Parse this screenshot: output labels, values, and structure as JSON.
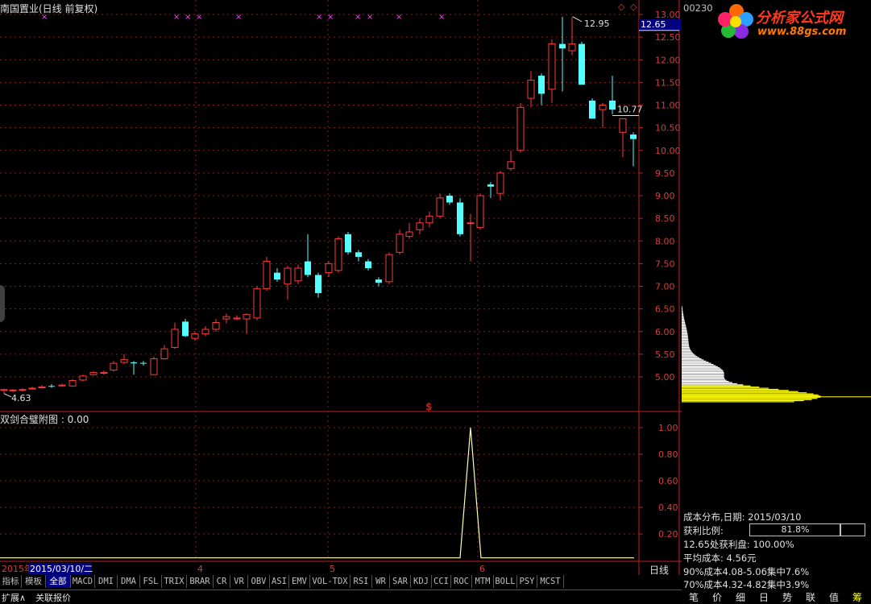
{
  "stock": {
    "title": "南国置业(日线 前复权)",
    "code": "00230"
  },
  "top_chart": {
    "price_axis": [
      "13.00",
      "12.50",
      "12.00",
      "11.50",
      "11.00",
      "10.50",
      "10.00",
      "9.50",
      "9.00",
      "8.50",
      "8.00",
      "7.50",
      "7.00",
      "6.50",
      "6.00",
      "5.50",
      "5.00"
    ],
    "high_label": "12.95",
    "mid_label": "10.77",
    "low_label": "4.63",
    "current_price": "12.65",
    "month_labels": [
      "4",
      "5",
      "6"
    ],
    "event_marker": "$",
    "top_markers": [
      "×",
      "× × ×",
      "×",
      "× ×",
      "× ×",
      "×",
      "×",
      "×"
    ]
  },
  "bottom_chart": {
    "title": "双剑合璧附图 : 0.00",
    "axis": [
      "1.00",
      "0.80",
      "0.60",
      "0.40",
      "0.20"
    ]
  },
  "time_axis": {
    "year_label": "2015年",
    "cursor_date": "2015/03/10/二"
  },
  "day_button": "日线",
  "zoom": {
    "plus": "+",
    "minus": "-"
  },
  "tabs": [
    "指标",
    "模板",
    "全部",
    "MACD",
    "DMI",
    "DMA",
    "FSL",
    "TRIX",
    "BRAR",
    "CR",
    "VR",
    "OBV",
    "ASI",
    "EMV",
    "VOL-TDX",
    "RSI",
    "WR",
    "SAR",
    "KDJ",
    "CCI",
    "ROC",
    "MTM",
    "BOLL",
    "PSY",
    "MCST"
  ],
  "active_tab": "全部",
  "bottom_bar": {
    "expand": "扩展∧",
    "quote": "关联报价"
  },
  "logo": {
    "main": "分析家公式网",
    "url": "www.88gs.com"
  },
  "cost_panel": {
    "title": "成本分布,日期: 2015/03/10",
    "profit_label": "获利比例:",
    "profit_value": "81.8%",
    "profit_fraction": 0.818,
    "line3": "12.65处获利盘: 100.00%",
    "line4": "平均成本: 4.56元",
    "line5": "90%成本4.08-5.06集中7.6%",
    "line6": "70%成本4.32-4.82集中3.9%"
  },
  "right_tabs": [
    "笔",
    "价",
    "细",
    "日",
    "势",
    "联",
    "值",
    "筹"
  ],
  "active_right_tab": "筹",
  "colors": {
    "up": "#ff3b3b",
    "down": "#54ffff",
    "grid": "#8b1a1a",
    "axis": "#c02020",
    "yellow": "#ffff00"
  }
}
